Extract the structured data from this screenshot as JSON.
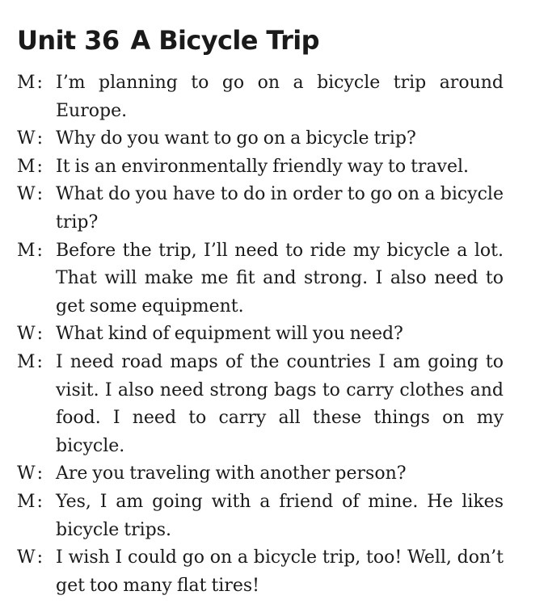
{
  "title": {
    "unit": "Unit 36",
    "name": "A Bicycle Trip"
  },
  "dialogue": [
    {
      "speaker": "M",
      "text": "I’m planning to go on a bicycle trip around Europe."
    },
    {
      "speaker": "W",
      "text": "Why do you want to go on a bicycle trip?"
    },
    {
      "speaker": "M",
      "text": "It is an environmentally friendly way to travel."
    },
    {
      "speaker": "W",
      "text": "What do you have to do in order to go on a bicycle trip?"
    },
    {
      "speaker": "M",
      "text": "Before the trip, I’ll need to ride my bicycle a lot. That will make me fit and strong. I also need to get some equipment."
    },
    {
      "speaker": "W",
      "text": "What kind of equipment will you need?"
    },
    {
      "speaker": "M",
      "text": "I need road maps of the countries I am going to visit. I also need strong bags to carry clothes and food. I need to carry all these things on my bicycle."
    },
    {
      "speaker": "W",
      "text": "Are you traveling with another person?"
    },
    {
      "speaker": "M",
      "text": "Yes, I am going with a friend of mine. He likes bicycle trips."
    },
    {
      "speaker": "W",
      "text": "I wish I could go on a bicycle trip, too! Well, don’t get too many flat tires!"
    }
  ]
}
